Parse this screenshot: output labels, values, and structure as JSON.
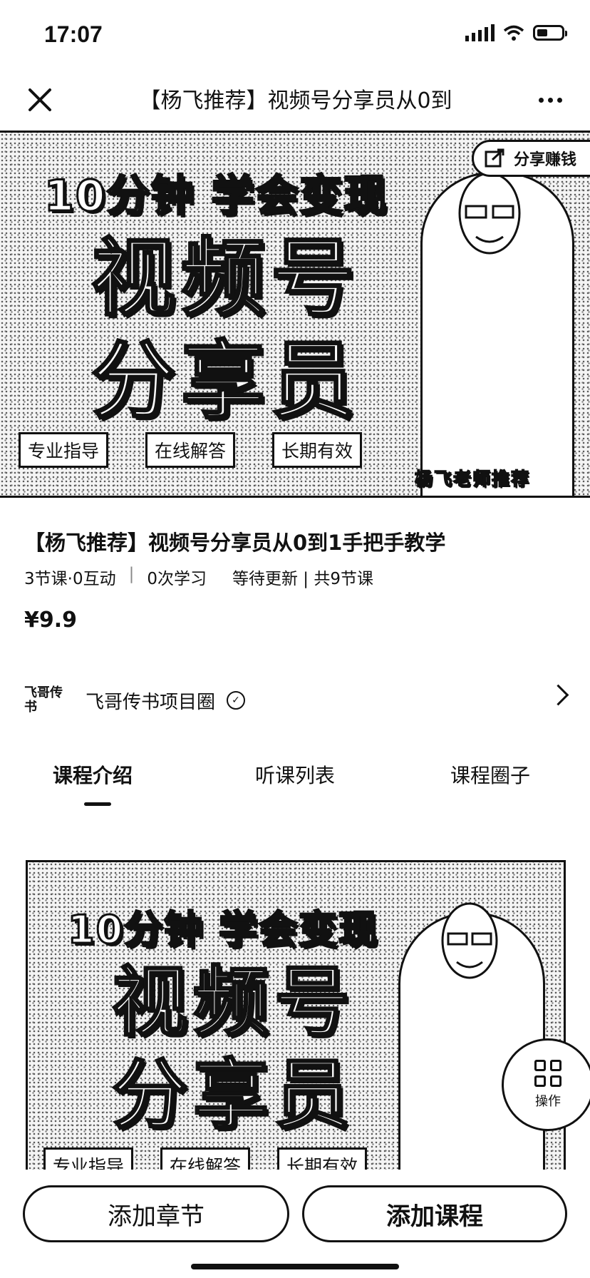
{
  "status_bar": {
    "time": "17:07"
  },
  "nav": {
    "title": "【杨飞推荐】视频号分享员从0到"
  },
  "banner": {
    "headline": "10分钟 学会变现",
    "big_line1": "视频号",
    "big_line2": "分享员",
    "tags": [
      "专业指导",
      "在线解答",
      "长期有效"
    ],
    "caption": "杨飞老师推荐",
    "share_label": "分享赚钱"
  },
  "course": {
    "title": "【杨飞推荐】视频号分享员从0到1手把手教学",
    "meta": {
      "lessons": "3节课·0互动",
      "learners": "0次学习",
      "update": "等待更新 | 共9节课"
    },
    "price": "¥9.9"
  },
  "author": {
    "logo_text": "飞哥传书",
    "name": "飞哥传书项目圈"
  },
  "tabs": [
    {
      "label": "课程介绍",
      "active": true
    },
    {
      "label": "听课列表",
      "active": false
    },
    {
      "label": "课程圈子",
      "active": false
    }
  ],
  "intro_poster": {
    "headline": "10分钟 学会变现",
    "big_line1": "视频号",
    "big_line2": "分享员",
    "tags": [
      "专业指导",
      "在线解答",
      "长期有效"
    ]
  },
  "fab": {
    "label": "操作"
  },
  "bottom_bar": {
    "add_chapter": "添加章节",
    "add_course": "添加课程"
  }
}
